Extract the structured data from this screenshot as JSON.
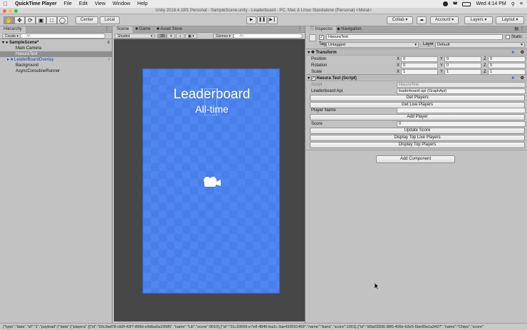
{
  "menubar": {
    "app_name": "QuickTime Player",
    "items": [
      "File",
      "Edit",
      "View",
      "Window",
      "Help"
    ],
    "clock": "Wed 4:14 PM"
  },
  "window_title": "Unity 2018.4.19f1 Personal - SampleScene.unity - Leaderboard - PC, Mac & Linux Standalone (Personal) <Metal>",
  "toolbar": {
    "center_label": "Center",
    "local_label": "Local",
    "collab_label": "Collab",
    "account_label": "Account",
    "layers_label": "Layers",
    "layout_label": "Layout"
  },
  "hierarchy": {
    "tab": "Hierarchy",
    "create_label": "Create",
    "search_placeholder": "All",
    "scene_name": "SampleScene*",
    "items": [
      {
        "label": "Main Camera"
      },
      {
        "label": "HasuraTest"
      },
      {
        "label": "LeaderBoardOverlay"
      },
      {
        "label": "Background"
      },
      {
        "label": "AsyncCoroutineRunner"
      }
    ]
  },
  "scene": {
    "tabs": [
      "Scene",
      "Game",
      "Asset Store"
    ],
    "shading": "Shaded",
    "mode_2d": "2D",
    "gizmos": "Gizmos",
    "search_placeholder": "All",
    "title": "Leaderboard",
    "subtitle": "All-time"
  },
  "inspector": {
    "tabs": [
      "Inspector",
      "Navigation"
    ],
    "object_name": "HasuraTest",
    "static_label": "Static",
    "tag_label": "Tag",
    "tag_value": "Untagged",
    "layer_label": "Layer",
    "layer_value": "Default",
    "transform": {
      "header": "Transform",
      "rows": [
        {
          "label": "Position",
          "x": "0",
          "y": "0",
          "z": "0"
        },
        {
          "label": "Rotation",
          "x": "0",
          "y": "0",
          "z": "0"
        },
        {
          "label": "Scale",
          "x": "1",
          "y": "1",
          "z": "1"
        }
      ]
    },
    "script_component": {
      "header": "Hasura Test (Script)",
      "script_label": "Script",
      "script_value": "HasuraTest",
      "api_label": "Leaderboard Api",
      "api_value": "leaderboard-api (GraphApi)",
      "buttons_top": [
        "Get Players",
        "Get Live Players"
      ],
      "player_name_label": "Player Name",
      "player_name_value": "",
      "add_player_label": "Add Player",
      "score_label": "Score",
      "score_value": "0",
      "buttons_bottom": [
        "Update Score",
        "Display Top Live Players",
        "Display Top Players"
      ]
    },
    "add_component_label": "Add Component"
  },
  "statusbar": {
    "text": "{\"type\":\"data\",\"id\":\"1\",\"payload\":{\"data\":{\"players\":[{\"id\":\"03c3ad78-cb0f-43f7-898d-e9dba0a19585\",\"name\":\"Lili\",\"score\":9010},{\"id\":\"31c33669-e7e8-4840-ba3c-3ae432691469\",\"name\":\"baris\",\"score\":1001},{\"id\":\"d0a03908-38f0-406e-b3e5-6be90a1a3427\",\"name\":\"Chips\",\"score\""
  }
}
